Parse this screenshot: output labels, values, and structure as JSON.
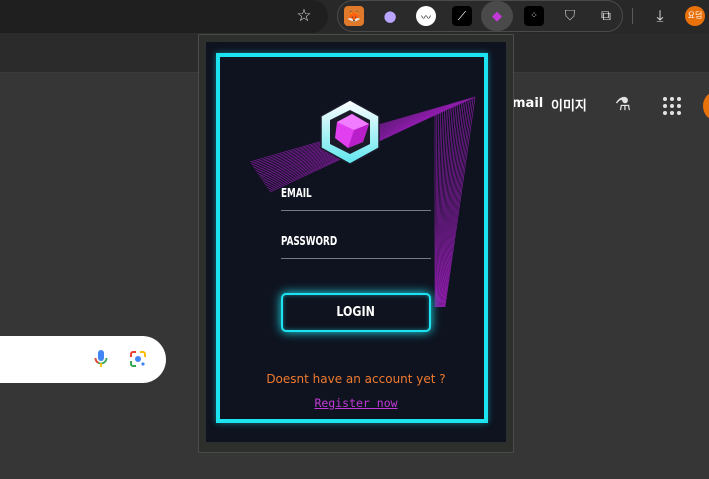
{
  "browser": {
    "toolbar_icons": [
      "bookmark-star-icon",
      "fox-extension-icon",
      "ghost-extension-icon",
      "chart-extension-icon",
      "wand-extension-icon",
      "active-extension-icon",
      "dice-extension-icon",
      "shield-extension-icon",
      "puzzle-extensions-icon",
      "download-icon"
    ],
    "profile_initials": "요덤"
  },
  "google": {
    "gmail_link": "mail",
    "images_link": "이미지",
    "labs_icon": "flask-icon",
    "apps_icon": "apps-grid-icon"
  },
  "popup": {
    "logo_icon": "hexagon-cube-logo",
    "email_label": "EMAIL",
    "password_label": "PASSWORD",
    "login_label": "LOGIN",
    "no_account_prompt": "Doesnt have an account yet ?",
    "register_link": "Register now",
    "colors": {
      "accent": "#1de3f0",
      "panel": "#0f1320",
      "prompt": "#f07a2d",
      "link": "#c23ad6",
      "art": "#b020d0"
    }
  }
}
